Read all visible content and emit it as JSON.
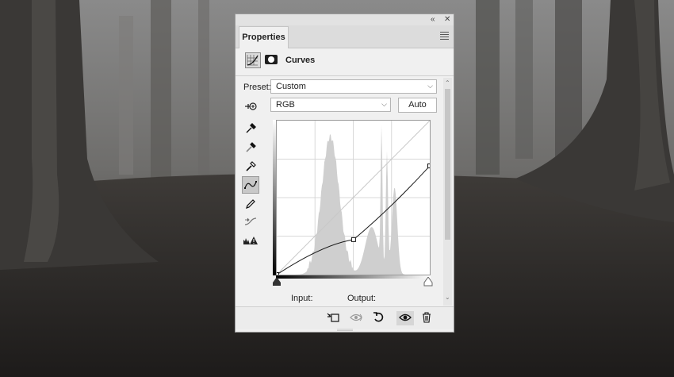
{
  "window": {
    "tab_label": "Properties",
    "collapse_icon": "double-chevron-left-icon",
    "close_icon": "close-icon",
    "menu_icon": "panel-menu-icon"
  },
  "adjustment": {
    "title": "Curves",
    "icon": "curves-adjustment-icon",
    "mask_icon": "layer-mask-icon"
  },
  "preset": {
    "label": "Preset:",
    "value": "Custom"
  },
  "channel": {
    "value": "RGB",
    "auto_label": "Auto"
  },
  "tools": [
    {
      "name": "on-image-adjust-icon"
    },
    {
      "name": "black-point-eyedropper-icon"
    },
    {
      "name": "gray-point-eyedropper-icon"
    },
    {
      "name": "white-point-eyedropper-icon"
    },
    {
      "name": "edit-points-curve-icon"
    },
    {
      "name": "pencil-draw-icon"
    },
    {
      "name": "smooth-curve-icon"
    },
    {
      "name": "clipping-warning-icon"
    }
  ],
  "curve": {
    "points": [
      [
        0,
        0
      ],
      [
        128,
        58
      ],
      [
        255,
        180
      ]
    ]
  },
  "io": {
    "input_label": "Input:",
    "input_value": "",
    "output_label": "Output:",
    "output_value": ""
  },
  "bottom_bar": [
    "clip-to-layer-icon",
    "view-previous-state-icon",
    "reset-icon",
    "visibility-eye-icon",
    "delete-trash-icon"
  ],
  "colors": {
    "panel_bg": "#f0f0f0",
    "histogram": "#cfcfcf",
    "curve": "#1a1a1a"
  }
}
